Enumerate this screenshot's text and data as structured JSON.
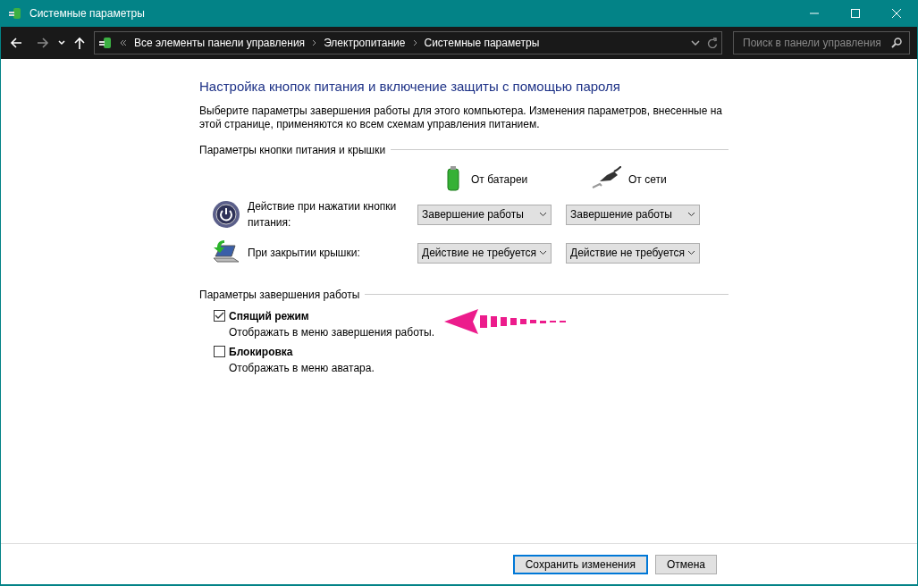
{
  "window": {
    "title": "Системные параметры"
  },
  "breadcrumb": [
    "Все элементы панели управления",
    "Электропитание",
    "Системные параметры"
  ],
  "search": {
    "placeholder": "Поиск в панели управления"
  },
  "heading": "Настройка кнопок питания и включение защиты с помощью пароля",
  "description": "Выберите параметры завершения работы для этого компьютера. Изменения параметров, внесенные на этой странице, применяются ко всем схемам управления питанием.",
  "power_section": {
    "title": "Параметры кнопки питания и крышки",
    "columns": [
      {
        "kind": "battery",
        "label": "От батареи"
      },
      {
        "kind": "plug",
        "label": "От сети"
      }
    ],
    "rows": [
      {
        "kind": "power",
        "label": "Действие при нажатии кнопки питания:",
        "values": [
          "Завершение работы",
          "Завершение работы"
        ]
      },
      {
        "kind": "lid",
        "label": "При закрытии крышки:",
        "values": [
          "Действие не требуется",
          "Действие не требуется"
        ]
      }
    ]
  },
  "shutdown_section": {
    "title": "Параметры завершения работы",
    "options": [
      {
        "label": "Спящий режим",
        "hint": "Отображать в меню завершения работы.",
        "checked": true
      },
      {
        "label": "Блокировка",
        "hint": "Отображать в меню аватара.",
        "checked": false
      }
    ]
  },
  "buttons": [
    {
      "label": "Сохранить изменения",
      "primary": true
    },
    {
      "label": "Отмена",
      "primary": false
    }
  ]
}
